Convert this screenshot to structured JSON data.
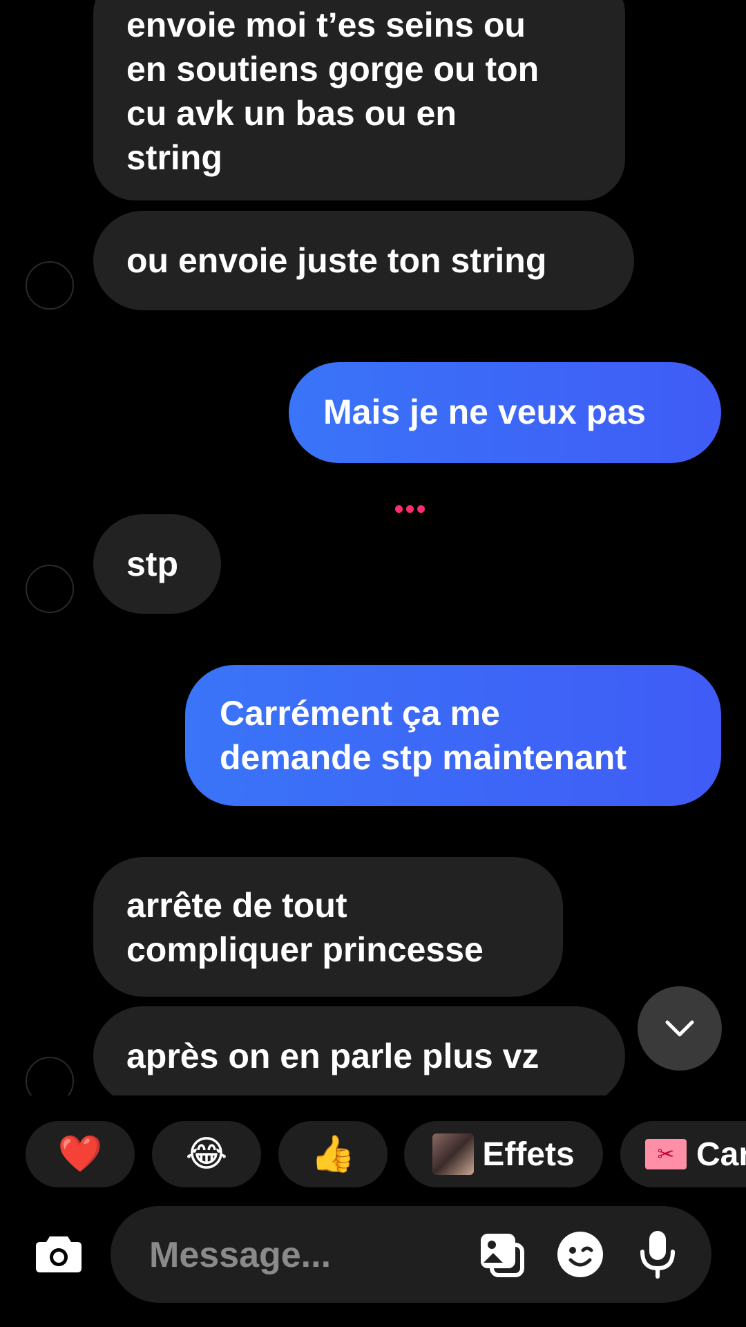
{
  "messages": [
    {
      "side": "in",
      "text": "envoie moi t’es seins ou\nen soutiens gorge ou ton\ncu avk un bas ou en\nstring"
    },
    {
      "side": "in",
      "text": "ou envoie juste ton string"
    },
    {
      "side": "out",
      "text": "Mais je ne veux pas"
    },
    {
      "side": "in",
      "text": "stp"
    },
    {
      "side": "out",
      "text": "Carrément ça me\ndemande stp maintenant"
    },
    {
      "side": "in",
      "text": "arrête de tout\ncompliquer princesse"
    },
    {
      "side": "in",
      "text": "après on en parle plus vz"
    }
  ],
  "reactions": {
    "heart": "❤️",
    "laugh": "😂",
    "thumbs_up": "👍",
    "effects_label": "Effets",
    "gift_label": "Car"
  },
  "composer": {
    "placeholder": "Message..."
  },
  "colors": {
    "background": "#000000",
    "incoming_bubble": "#222222",
    "outgoing_bubble": "#3a74f8",
    "typing_dots": "#ff2d6f"
  },
  "icons": [
    "camera-icon",
    "gallery-icon",
    "sticker-icon",
    "microphone-icon",
    "chevron-down-icon"
  ]
}
